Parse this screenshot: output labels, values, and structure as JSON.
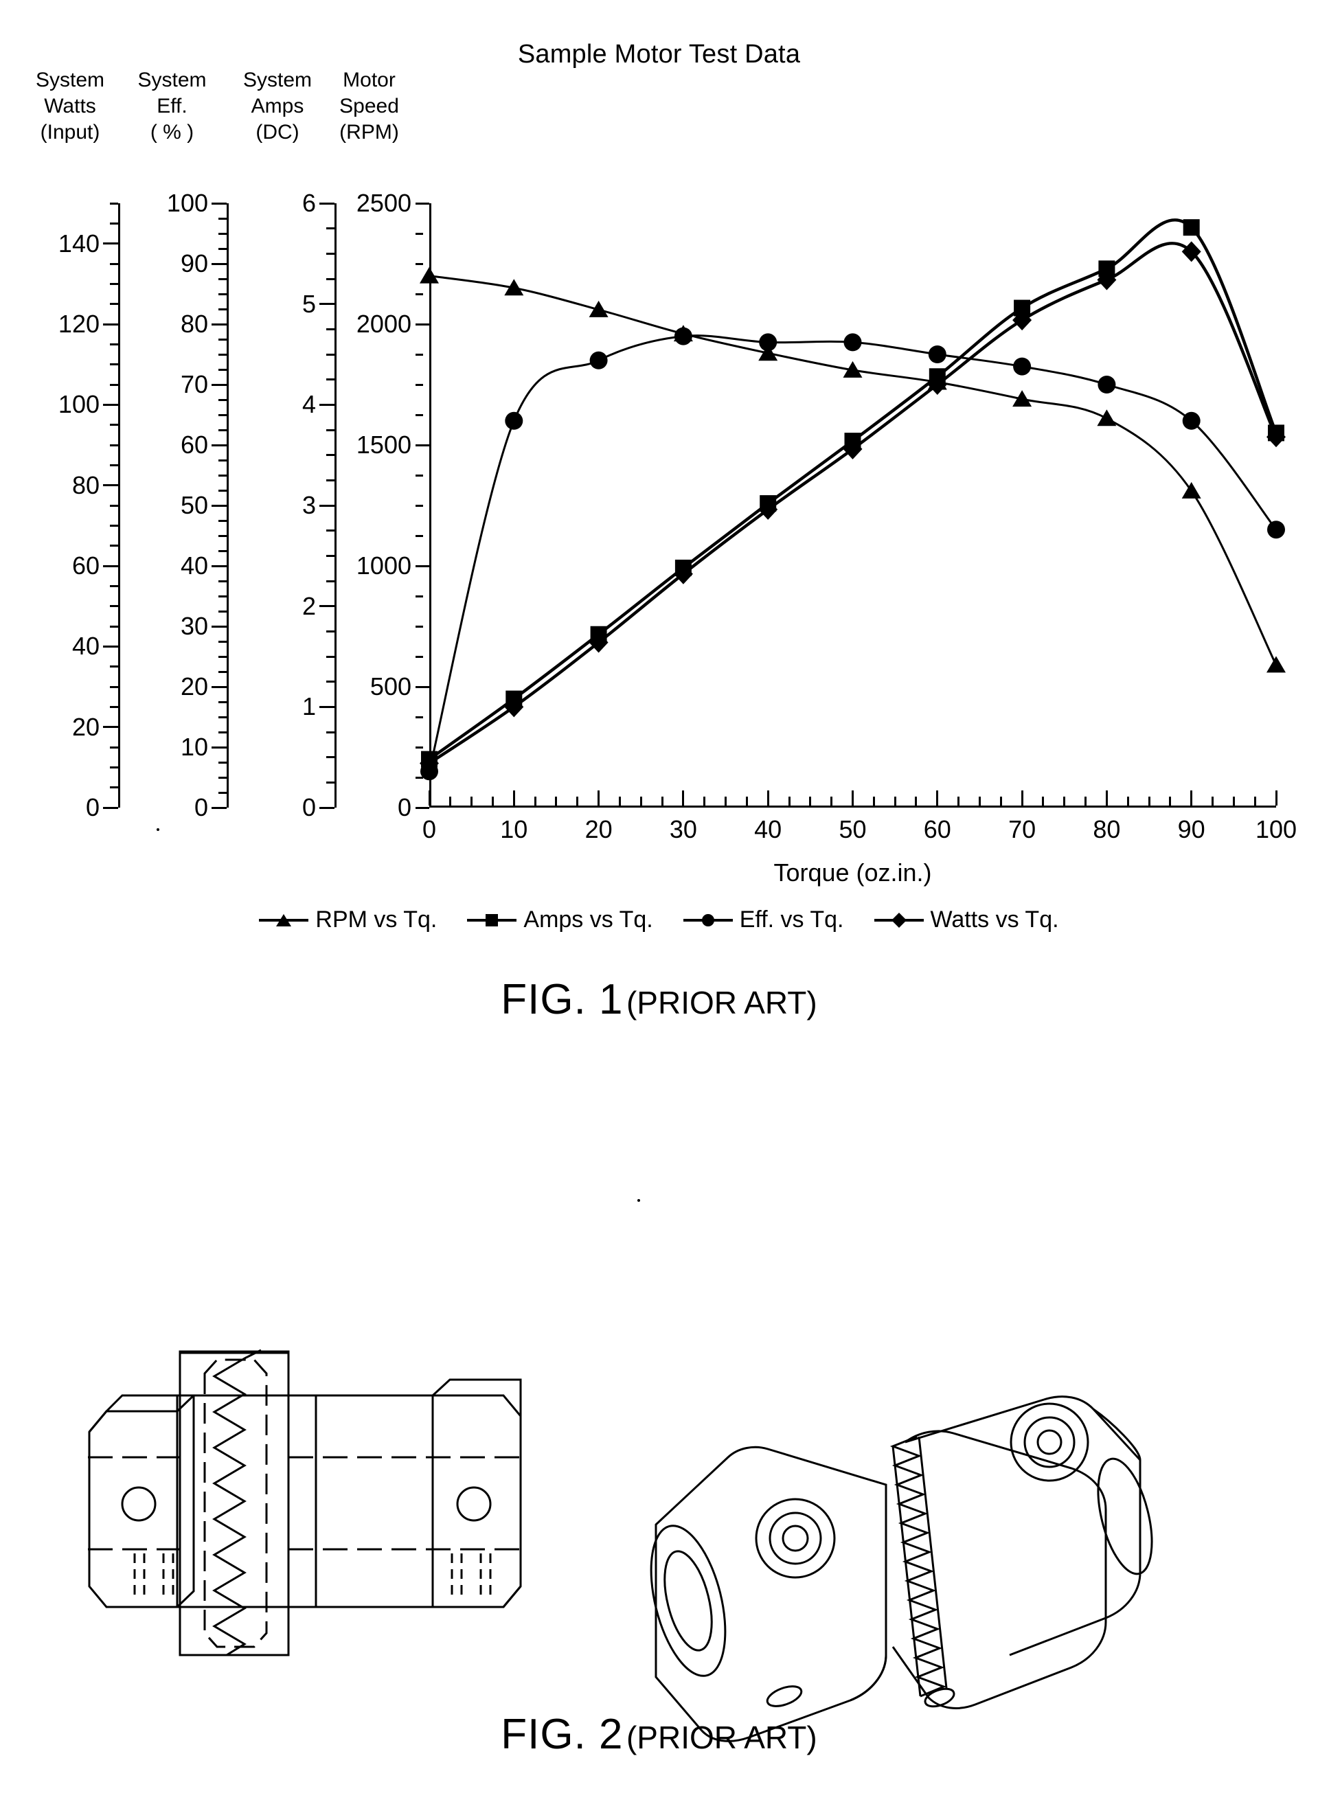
{
  "figure1": {
    "title": "Sample Motor Test Data",
    "caption_number": "FIG. 1",
    "caption_note": "(PRIOR ART)",
    "axis_headers": [
      {
        "name": "system-watts",
        "l1": "System",
        "l2": "Watts",
        "l3": "(Input)"
      },
      {
        "name": "system-eff",
        "l1": "System",
        "l2": "Eff.",
        "l3": "( % )"
      },
      {
        "name": "system-amps",
        "l1": "System",
        "l2": "Amps",
        "l3": "(DC)"
      },
      {
        "name": "motor-speed",
        "l1": "Motor",
        "l2": "Speed",
        "l3": "(RPM)"
      }
    ],
    "xaxis_title": "Torque (oz.in.)",
    "legend": [
      {
        "label": "RPM vs Tq.",
        "marker": "triangle-marker"
      },
      {
        "label": "Amps vs Tq.",
        "marker": "square-marker"
      },
      {
        "label": "Eff. vs Tq.",
        "marker": "circle-marker"
      },
      {
        "label": "Watts vs Tq.",
        "marker": "diamond-marker"
      }
    ]
  },
  "figure2": {
    "caption_number": "FIG. 2",
    "caption_note": "(PRIOR ART)",
    "parts": [
      {
        "name": "jaw-coupling-front-view"
      },
      {
        "name": "jaw-coupling-isometric-view"
      }
    ]
  },
  "chart_data": {
    "type": "line",
    "title": "Sample Motor Test Data",
    "xlabel": "Torque (oz.in.)",
    "ylabel": "",
    "x": [
      0,
      10,
      20,
      30,
      40,
      50,
      60,
      70,
      80,
      90,
      100
    ],
    "xlim": [
      0,
      100
    ],
    "xticks": [
      0,
      10,
      20,
      30,
      40,
      50,
      60,
      70,
      80,
      90,
      100
    ],
    "grid": false,
    "legend_position": "bottom",
    "axes": [
      {
        "name": "System Watts (Input)",
        "ticks": [
          0,
          20,
          40,
          60,
          80,
          100,
          120,
          140
        ],
        "lim": [
          0,
          150
        ],
        "minor_step": 5
      },
      {
        "name": "System Eff. ( % )",
        "ticks": [
          0,
          10,
          20,
          30,
          40,
          50,
          60,
          70,
          80,
          90,
          100
        ],
        "lim": [
          0,
          100
        ],
        "minor_step": 2.5
      },
      {
        "name": "System Amps (DC)",
        "ticks": [
          0,
          1,
          2,
          3,
          4,
          5,
          6
        ],
        "lim": [
          0,
          6
        ],
        "minor_step": 0.25
      },
      {
        "name": "Motor Speed (RPM)",
        "ticks": [
          0,
          500,
          1000,
          1500,
          2000,
          2500
        ],
        "lim": [
          0,
          2500
        ],
        "minor_step": 125
      }
    ],
    "series": [
      {
        "name": "RPM vs Tq.",
        "marker": "triangle",
        "axis": "Motor Speed (RPM)",
        "unit": "RPM",
        "x": [
          0,
          10,
          20,
          30,
          40,
          50,
          60,
          70,
          80,
          90,
          100
        ],
        "values": [
          2200,
          2150,
          2060,
          1960,
          1880,
          1810,
          1760,
          1690,
          1610,
          1310,
          590
        ]
      },
      {
        "name": "Amps vs Tq.",
        "marker": "square",
        "axis": "System Amps (DC)",
        "unit": "A",
        "x": [
          0,
          10,
          20,
          30,
          40,
          50,
          60,
          70,
          80,
          90,
          100
        ],
        "values": [
          0.48,
          1.08,
          1.72,
          2.38,
          3.02,
          3.64,
          4.28,
          4.96,
          5.35,
          5.76,
          3.72
        ]
      },
      {
        "name": "Eff. vs Tq.",
        "marker": "circle",
        "axis": "System Eff. ( % )",
        "unit": "%",
        "x": [
          0,
          10,
          20,
          30,
          40,
          50,
          60,
          70,
          80,
          90,
          100
        ],
        "values": [
          6,
          64,
          74,
          78,
          77,
          77,
          75,
          73,
          70,
          64,
          46
        ]
      },
      {
        "name": "Watts vs Tq.",
        "marker": "diamond",
        "axis": "System Watts (Input)",
        "unit": "W",
        "x": [
          0,
          10,
          20,
          30,
          40,
          50,
          60,
          70,
          80,
          90,
          100
        ],
        "values": [
          11,
          25,
          41,
          58,
          74,
          89,
          105,
          121,
          131,
          138,
          92
        ]
      }
    ]
  }
}
